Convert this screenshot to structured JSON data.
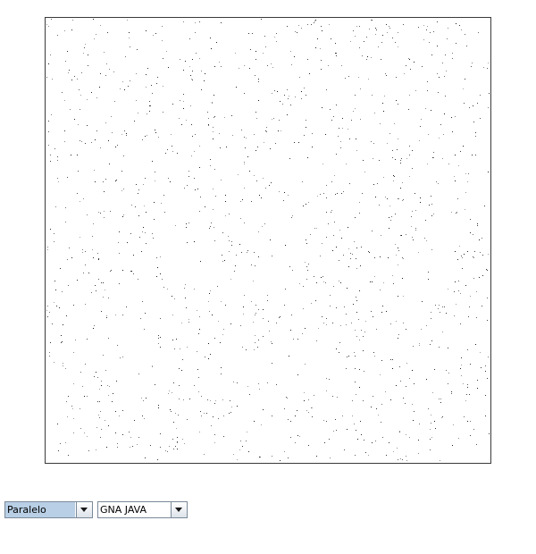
{
  "plot": {
    "description_dots": "random points scattered",
    "point_color": "#000000",
    "background_color": "#ffffff"
  },
  "controls": {
    "mode_combo": {
      "selected": "Paralelo"
    },
    "generator_combo": {
      "selected": "GNA JAVA"
    }
  }
}
